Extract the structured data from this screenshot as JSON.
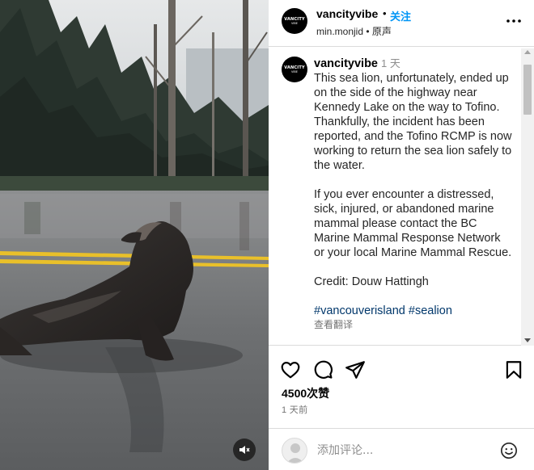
{
  "post": {
    "username": "vancityvibe",
    "avatar_text_1": "VANCITY",
    "avatar_text_2": "VIBE",
    "follow_label": "关注",
    "original_audio_user": "min.monjid",
    "separator": "•",
    "original_audio_label": "原声",
    "more_icon": "more-horizontal-icon"
  },
  "caption": {
    "username": "vancityvibe",
    "time": "1 天",
    "paragraph_1": "This sea lion, unfortunately, ended up on the side of the highway near Kennedy Lake on the way to Tofino. Thankfully, the incident has been reported, and the Tofino RCMP is now working to return the sea lion safely to the water.",
    "paragraph_2": "If you ever encounter a distressed, sick, injured, or abandoned marine mammal please contact the BC Marine Mammal Response Network or your local Marine Mammal Rescue.",
    "credit": "Credit: Douw Hattingh",
    "hashtag_1": "#vancouverisland",
    "hashtag_2": "#sealion",
    "translate_label": "查看翻译"
  },
  "actions": {
    "like_icon": "heart-icon",
    "comment_icon": "comment-bubble-icon",
    "share_icon": "paper-plane-icon",
    "save_icon": "bookmark-icon"
  },
  "likes_text": "4500次赞",
  "time_ago": "1 天前",
  "comment": {
    "placeholder": "添加评论...",
    "emoji_icon": "smiley-icon"
  },
  "media": {
    "mute_icon": "speaker-muted-icon"
  },
  "colors": {
    "follow_blue": "#0095f6",
    "hashtag_blue": "#00376b",
    "secondary_gray": "#737373",
    "border": "#dbdbdb"
  }
}
